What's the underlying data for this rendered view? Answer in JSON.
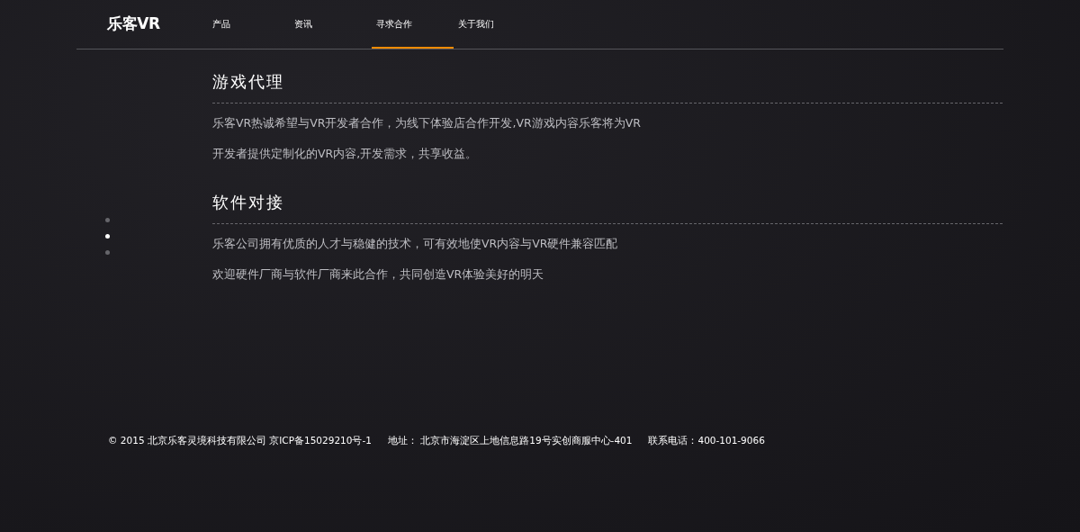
{
  "logo": "乐客VR",
  "nav": [
    {
      "label": "产品",
      "selected": false
    },
    {
      "label": "资讯",
      "selected": false
    },
    {
      "label": "寻求合作",
      "selected": true
    },
    {
      "label": "关于我们",
      "selected": false
    }
  ],
  "pager": [
    {
      "selected": false
    },
    {
      "selected": true
    },
    {
      "selected": false
    }
  ],
  "sections": [
    {
      "title": "游戏代理",
      "paragraphs": [
        "乐客VR热诚希望与VR开发者合作，为线下体验店合作开发,VR游戏内容乐客将为VR",
        "开发者提供定制化的VR内容,开发需求，共享收益。"
      ]
    },
    {
      "title": "软件对接",
      "paragraphs": [
        "乐客公司拥有优质的人才与稳健的技术，可有效地使VR内容与VR硬件兼容匹配",
        "欢迎硬件厂商与软件厂商来此合作，共同创造VR体验美好的明天"
      ]
    }
  ],
  "footer": {
    "copyright": "© 2015 北京乐客灵境科技有限公司 京ICP备15029210号-1",
    "address": "地址： 北京市海淀区上地信息路19号实创商服中心-401",
    "phone": "联系电话：400-101-9066"
  }
}
